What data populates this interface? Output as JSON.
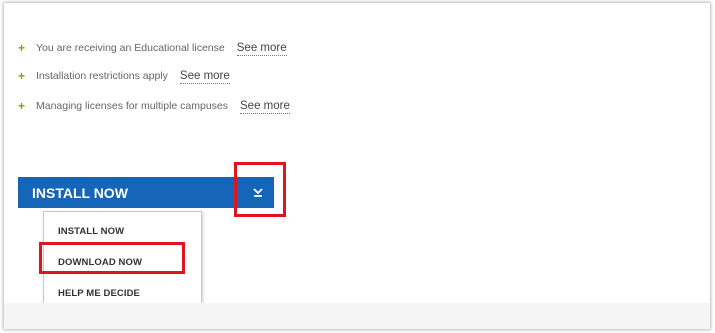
{
  "info_items": [
    {
      "text": "You are receiving an Educational license",
      "link": "See more"
    },
    {
      "text": "Installation restrictions apply",
      "link": "See more"
    },
    {
      "text": "Managing licenses for multiple campuses",
      "link": "See more"
    }
  ],
  "install_button": {
    "label": "INSTALL NOW",
    "toggle_icon": "chevron-down-icon"
  },
  "dropdown": {
    "items": [
      "INSTALL NOW",
      "DOWNLOAD NOW",
      "HELP ME DECIDE"
    ]
  },
  "colors": {
    "accent_blue": "#1565b8",
    "highlight_red": "#e0141e",
    "bullet_green": "#7aa800"
  }
}
